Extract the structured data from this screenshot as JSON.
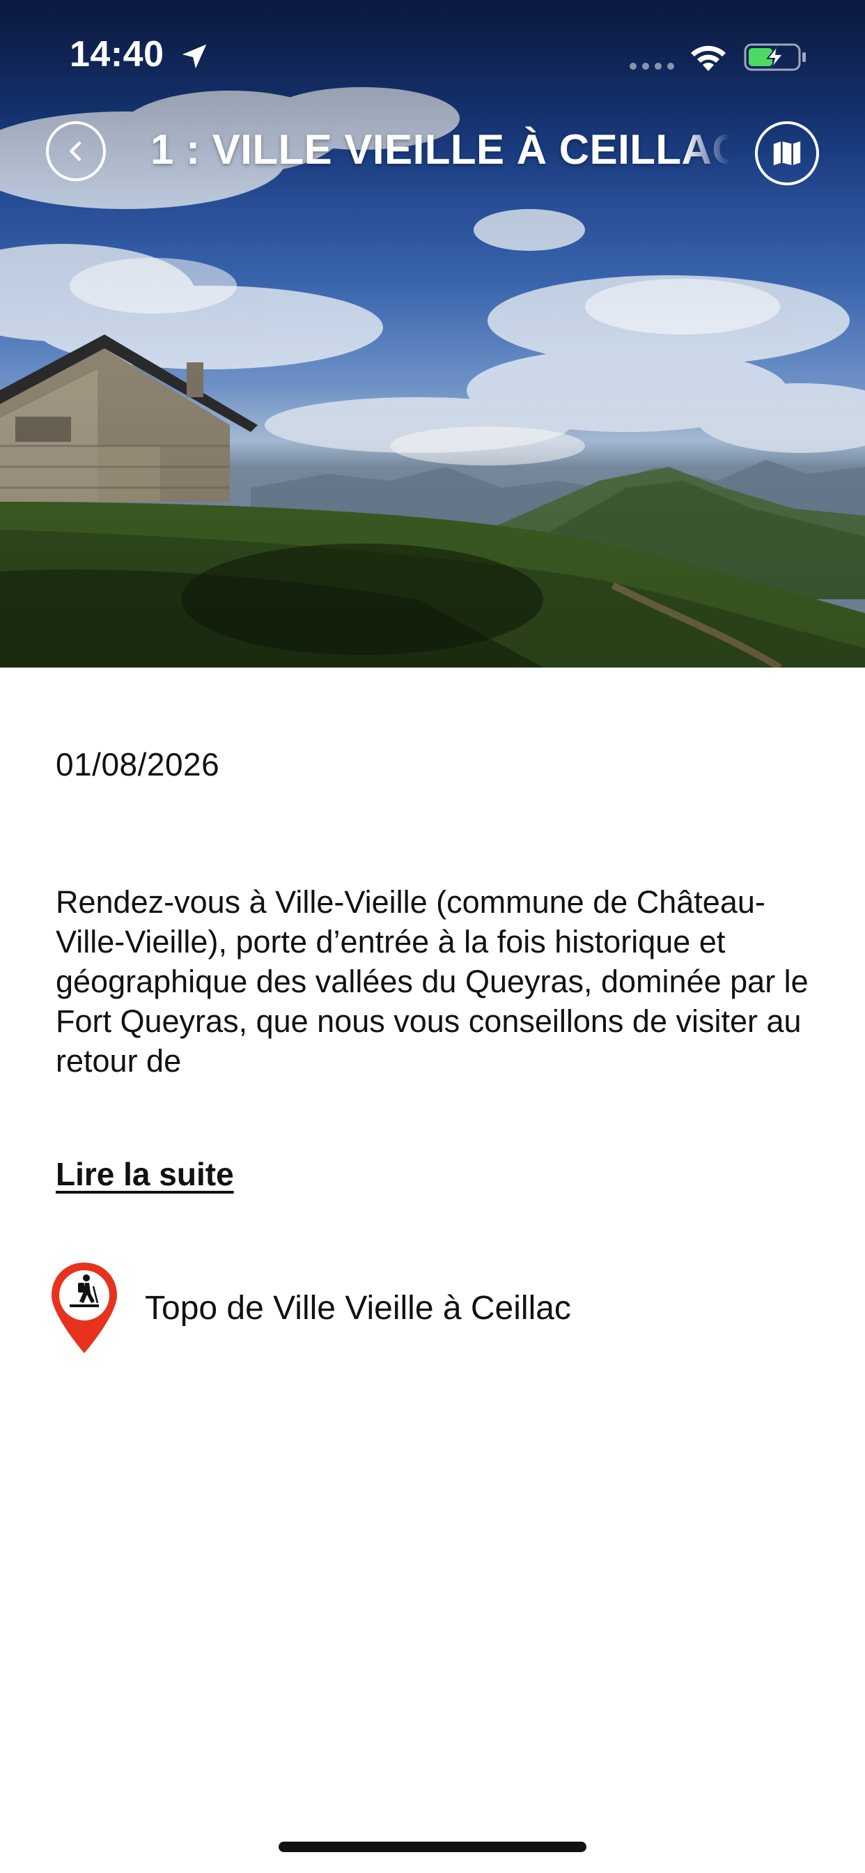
{
  "status_bar": {
    "time": "14:40",
    "location_icon": "location-arrow-icon",
    "signal_icon": "cellular-signal-icon",
    "wifi_icon": "wifi-icon",
    "battery_icon": "battery-charging-icon",
    "battery_color": "#4cd964"
  },
  "header": {
    "back_icon": "chevron-left-icon",
    "title": "1  : VILLE VIEILLE À CEILLAC",
    "map_icon": "map-icon"
  },
  "hero": {
    "image_subject": "mountain-landscape-photo"
  },
  "content": {
    "date": "01/08/2026",
    "description": "Rendez-vous à Ville-Vieille (commune de Château-Ville-Vieille), porte d’entrée à la fois historique et géographique des vallées du Queyras, dominée par le Fort Queyras, que nous vous conseillons de visiter au retour de",
    "read_more": "Lire la suite",
    "topo": {
      "icon": "hiker-pin-icon",
      "label": "Topo de Ville Vieille à Ceillac",
      "pin_color": "#e8321e"
    }
  },
  "colors": {
    "text": "#111111",
    "background": "#ffffff",
    "pin": "#e8321e"
  }
}
